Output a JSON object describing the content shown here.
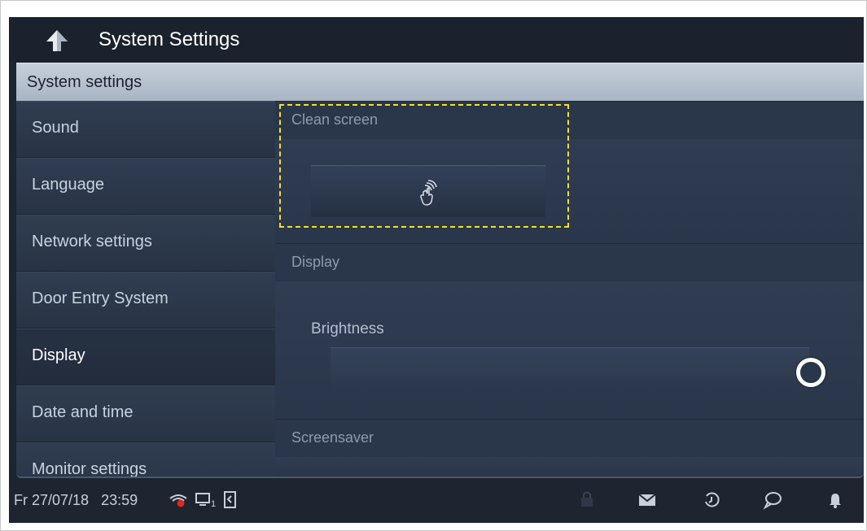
{
  "header": {
    "title": "System Settings"
  },
  "section": {
    "title": "System settings"
  },
  "menu": {
    "items": [
      {
        "label": "Sound"
      },
      {
        "label": "Language"
      },
      {
        "label": "Network settings"
      },
      {
        "label": "Door Entry System"
      },
      {
        "label": "Display"
      },
      {
        "label": "Date and time"
      },
      {
        "label": "Monitor settings"
      }
    ],
    "active": "Display"
  },
  "clean_screen": {
    "title": "Clean screen",
    "icon": "hand-wipe-icon"
  },
  "display": {
    "title": "Display",
    "brightness": {
      "label": "Brightness",
      "level": 1.0
    }
  },
  "screensaver": {
    "title": "Screensaver"
  },
  "status": {
    "date": "Fr 27/07/18",
    "time": "23:59",
    "monitor_index": "1",
    "icons": [
      "wifi-off-icon",
      "monitor-icon",
      "door-icon",
      "lock-icon",
      "mail-icon",
      "history-icon",
      "chat-icon",
      "bell-icon"
    ]
  },
  "colors": {
    "accent_highlight": "#f2e224",
    "wifi_alert": "#e0281e",
    "background": "#1e2430"
  }
}
